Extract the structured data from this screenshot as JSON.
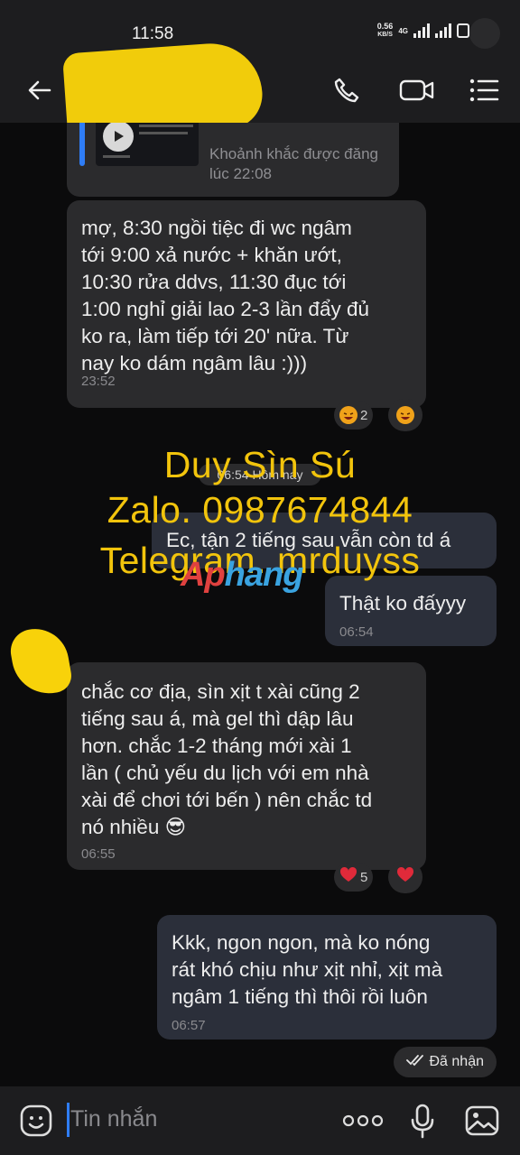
{
  "status_bar": {
    "time": "11:58",
    "net_speed": "0.56",
    "net_unit": "KB/S",
    "net_type": "4G"
  },
  "header": {
    "back_icon": "arrow-left-icon",
    "call_icon": "phone-icon",
    "video_icon": "video-camera-icon",
    "menu_icon": "list-menu-icon"
  },
  "messages": [
    {
      "direction": "in",
      "kind": "media-card",
      "caption": "Khoảnh khắc được đăng\nlúc 22:08",
      "icon": "play-icon"
    },
    {
      "direction": "in",
      "text": "mợ, 8:30 ngồi tiệc đi wc ngâm\ntới 9:00 xả nước + khăn ướt,\n10:30 rửa ddvs, 11:30 đục tới\n1:00 nghỉ giải lao 2-3 lần đẩy đủ\nko ra, làm tiếp tới 20' nữa. Từ\nnay ko dám ngâm lâu :)))",
      "time": "23:52",
      "reactions": [
        {
          "emoji": "laughing-face-icon",
          "count": "2"
        },
        {
          "emoji": "laughing-face-icon",
          "count": ""
        }
      ]
    },
    {
      "direction": "out",
      "text": "Ec, tận 2 tiếng sau vẫn còn td á",
      "time": ""
    },
    {
      "direction": "out",
      "text": "Thật ko đấyyy",
      "time": "06:54"
    },
    {
      "direction": "in",
      "text": "chắc cơ địa, sìn xịt t xài cũng 2\ntiếng sau á, mà gel thì dập lâu\nhơn. chắc 1-2 tháng mới xài 1\nlần ( chủ yếu du lịch với em nhà\nxài để chơi tới bến ) nên chắc td\nnó nhiều 😎",
      "time": "06:55",
      "reactions": [
        {
          "emoji": "heart-icon",
          "count": "5"
        },
        {
          "emoji": "heart-icon",
          "count": ""
        }
      ]
    },
    {
      "direction": "out",
      "text": "Kkk, ngon ngon, mà ko nóng\nrát khó chịu như xịt nhỉ, xịt mà\nngâm 1 tiếng thì thôi rồi luôn",
      "time": "06:57"
    }
  ],
  "date_separator": "06:54 Hôm nay",
  "received_status": "Đã nhận",
  "watermark": {
    "line1": "Duy Sìn Sú",
    "line2": "Zalo. 0987674844",
    "line3": "Telegram. mrduyss",
    "logo_a": "Ap",
    "logo_b": "hang"
  },
  "input_bar": {
    "placeholder": "Tin nhắn",
    "emoji_icon": "smiley-icon",
    "more_icon": "more-dots-icon",
    "mic_icon": "microphone-icon",
    "image_icon": "image-icon"
  },
  "colors": {
    "background": "#0b0b0c",
    "bubble": "#2b2b2d",
    "accent": "#2f7df6",
    "watermark": "#f2c40c"
  }
}
